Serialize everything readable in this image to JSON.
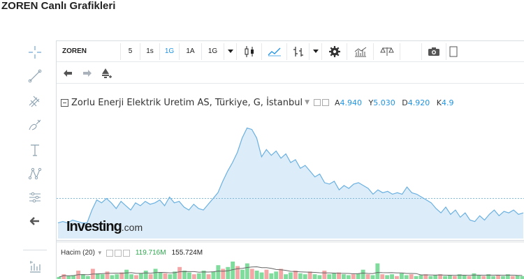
{
  "page": {
    "title": "ZOREN Canlı Grafikleri"
  },
  "toolbar": {
    "symbol": "ZOREN",
    "intervals": [
      {
        "label": "5",
        "active": false
      },
      {
        "label": "1s",
        "active": false
      },
      {
        "label": "1G",
        "active": true
      },
      {
        "label": "1A",
        "active": false
      },
      {
        "label": "1G",
        "active": false
      }
    ],
    "icons": [
      "dropdown-caret-icon",
      "candlestick-icon",
      "line-chart-icon",
      "bars-icon",
      "dropdown-caret-icon",
      "settings-gear-icon",
      "indicators-icon",
      "compare-scale-icon",
      "camera-icon"
    ]
  },
  "chart": {
    "legend": {
      "title": "Zorlu Enerji Elektrik Uretim AS, Türkiye, G, İstanbul",
      "a_label": "A",
      "a_value": "4.940",
      "y_label": "Y",
      "y_value": "5.030",
      "d_label": "D",
      "d_value": "4.920",
      "k_label": "K",
      "k_value": "4.9"
    },
    "line_color": "#6ab0e0",
    "fill_color": "#dcedf9"
  },
  "logo": {
    "main": "Investing",
    "domain": ".com"
  },
  "volume": {
    "label": "Hacim (20)",
    "value1": "119.716M",
    "value2": "155.724M"
  },
  "chart_data": {
    "type": "area",
    "title": "Zorlu Enerji Elektrik Uretim AS, Türkiye, G, İstanbul",
    "xlabel": "",
    "ylabel": "",
    "series": [
      {
        "values": [
          4.46,
          4.47,
          4.46,
          4.48,
          4.47,
          4.46,
          4.46,
          4.55,
          4.62,
          4.6,
          4.63,
          4.6,
          4.56,
          4.61,
          4.58,
          4.55,
          4.6,
          4.58,
          4.61,
          4.59,
          4.6,
          4.62,
          4.58,
          4.64,
          4.6,
          4.61,
          4.57,
          4.55,
          4.59,
          4.56,
          4.55,
          4.59,
          4.63,
          4.67,
          4.75,
          4.82,
          4.88,
          4.95,
          5.05,
          5.12,
          5.11,
          5.05,
          4.92,
          4.97,
          4.93,
          4.96,
          4.91,
          4.94,
          4.88,
          4.9,
          4.84,
          4.86,
          4.82,
          4.78,
          4.8,
          4.74,
          4.73,
          4.75,
          4.69,
          4.72,
          4.7,
          4.73,
          4.74,
          4.72,
          4.7,
          4.66,
          4.69,
          4.67,
          4.68,
          4.66,
          4.67,
          4.66,
          4.71,
          4.67,
          4.66,
          4.64,
          4.62,
          4.6,
          4.56,
          4.53,
          4.57,
          4.52,
          4.55,
          4.5,
          4.53,
          4.48,
          4.47,
          4.51,
          4.48,
          4.52,
          4.55,
          4.51,
          4.54,
          4.53,
          4.55,
          4.52,
          4.53
        ]
      }
    ]
  },
  "volume_data": {
    "bars": [
      0.15,
      0.3,
      0.2,
      0.25,
      0.5,
      0.3,
      0.2,
      0.6,
      0.35,
      0.3,
      0.45,
      0.25,
      0.3,
      0.4,
      0.55,
      0.3,
      0.25,
      0.35,
      0.5,
      0.3,
      0.6,
      0.4,
      0.35,
      0.3,
      0.45,
      0.7,
      0.5,
      0.4,
      0.3,
      0.35,
      0.5,
      0.3,
      0.45,
      0.8,
      0.6,
      0.7,
      1.0,
      0.75,
      0.55,
      0.9,
      0.6,
      0.5,
      0.4,
      0.55,
      0.35,
      0.45,
      0.6,
      0.3,
      0.4,
      0.5,
      0.35,
      0.3,
      0.45,
      0.3,
      0.25,
      0.5,
      0.3,
      0.35,
      0.4,
      0.3,
      0.25,
      0.3,
      0.35,
      0.55,
      0.3,
      0.25,
      0.9,
      0.3,
      0.25,
      0.3,
      0.2,
      0.35,
      0.25,
      0.3,
      0.2,
      0.25,
      0.3,
      0.2,
      0.25,
      0.3,
      0.2,
      0.25,
      0.2,
      0.3,
      0.25,
      0.2,
      0.35,
      0.25,
      0.2,
      0.3,
      0.2,
      0.25,
      0.2,
      0.3,
      0.2,
      0.25,
      0.2
    ],
    "up_color": "#7fdc9c",
    "down_color": "#f4a6a6",
    "ma_color": "#666666"
  }
}
